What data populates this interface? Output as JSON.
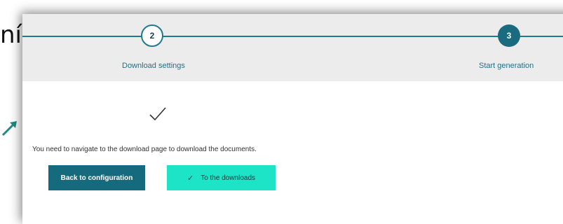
{
  "background": {
    "text": "ní:"
  },
  "stepper": {
    "steps": [
      {
        "number": "2",
        "label": "Download settings"
      },
      {
        "number": "3",
        "label": "Start generation"
      }
    ]
  },
  "main": {
    "message": "You need to navigate to the download page to download the documents.",
    "back_button_label": "Back to configuration",
    "downloads_button_label": "To the downloads",
    "downloads_button_icon": "✓"
  },
  "colors": {
    "primary": "#156a7d",
    "accent": "#1de4c7",
    "stepper_bg": "#ececec"
  }
}
